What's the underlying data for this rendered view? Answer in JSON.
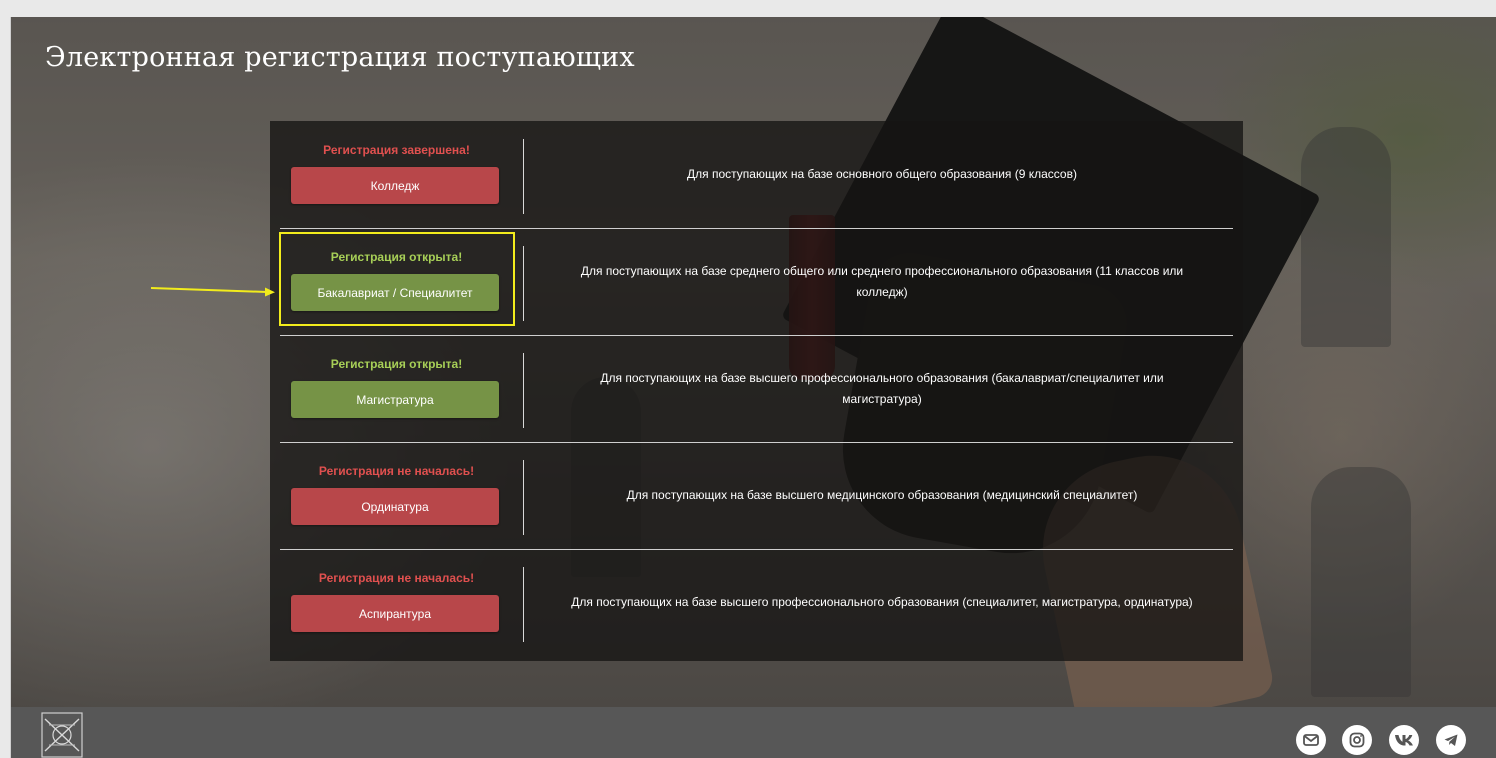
{
  "page": {
    "title": "Электронная регистрация поступающих"
  },
  "programs": [
    {
      "status": "Регистрация завершена!",
      "status_color": "#e0504f",
      "button": "Колледж",
      "button_color": "#b8474a",
      "description": [
        "Для поступающих на базе основного общего образования (9 классов)"
      ]
    },
    {
      "status": "Регистрация открыта!",
      "status_color": "#a7cf57",
      "button": "Бакалавриат / Специалитет",
      "button_color": "#769346",
      "description": [
        "Для поступающих на базе среднего общего или среднего профессионального образования (11 классов или",
        "колледж)"
      ],
      "highlighted": true
    },
    {
      "status": "Регистрация открыта!",
      "status_color": "#a7cf57",
      "button": "Магистратура",
      "button_color": "#769346",
      "description": [
        "Для поступающих на базе высшего профессионального образования (бакалавриат/специалитет или",
        "магистратура)"
      ]
    },
    {
      "status": "Регистрация не началась!",
      "status_color": "#e0504f",
      "button": "Ординатура",
      "button_color": "#b8474a",
      "description": [
        "Для поступающих на базе высшего медицинского образования (медицинский специалитет)"
      ]
    },
    {
      "status": "Регистрация не началась!",
      "status_color": "#e0504f",
      "button": "Аспирантура",
      "button_color": "#b8474a",
      "description": [
        "Для поступающих на базе высшего профессионального образования (специалитет, магистратура, ординатура)"
      ]
    }
  ],
  "annotation": {
    "highlight_color": "#f2ec1c"
  },
  "footer": {
    "logo": "university-logo",
    "social_icons": [
      "mail-icon",
      "instagram-icon",
      "vk-icon",
      "telegram-icon"
    ]
  }
}
